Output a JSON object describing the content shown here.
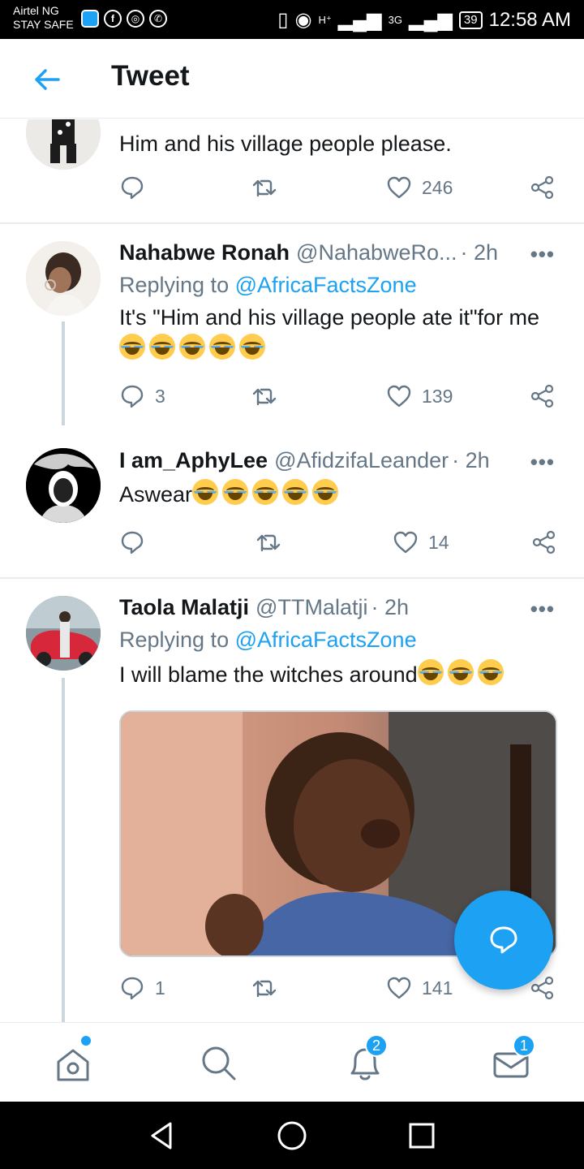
{
  "status_bar": {
    "carrier": "Airtel NG",
    "carrier_sub": "STAY SAFE",
    "network_h": "H⁺",
    "network_3g": "3G",
    "battery": "39",
    "time": "12:58 AM"
  },
  "header": {
    "title": "Tweet",
    "back_icon": "arrow-left-icon"
  },
  "tweets": [
    {
      "body": "Him and his village people please.",
      "reply_count": "",
      "retweet_count": "",
      "like_count": "246"
    },
    {
      "name": "Nahabwe Ronah",
      "handle": "@NahabweRo...",
      "time": "· 2h",
      "replying_prefix": "Replying to",
      "replying_to": "@AfricaFactsZone",
      "body": "It's \"Him and his village people ate it\"for me",
      "emoji_count": 5,
      "reply_count": "3",
      "like_count": "139"
    },
    {
      "name": "I am_AphyLee",
      "handle": "@AfidzifaLeander",
      "time": "· 2h",
      "body": "Aswear",
      "emoji_count": 5,
      "reply_count": "",
      "like_count": "14"
    },
    {
      "name": "Taola Malatji",
      "handle": "@TTMalatji",
      "time": "· 2h",
      "replying_prefix": "Replying to",
      "replying_to": "@AfricaFactsZone",
      "body": "I will blame the witches around",
      "emoji_count": 3,
      "reply_count": "1",
      "like_count": "141"
    }
  ],
  "more_label": "•••",
  "bottom_nav": {
    "notifications_badge": "2",
    "messages_badge": "1"
  },
  "colors": {
    "accent": "#1da1f2",
    "muted": "#657786",
    "text": "#14171a",
    "divider": "#e6ecf0"
  }
}
